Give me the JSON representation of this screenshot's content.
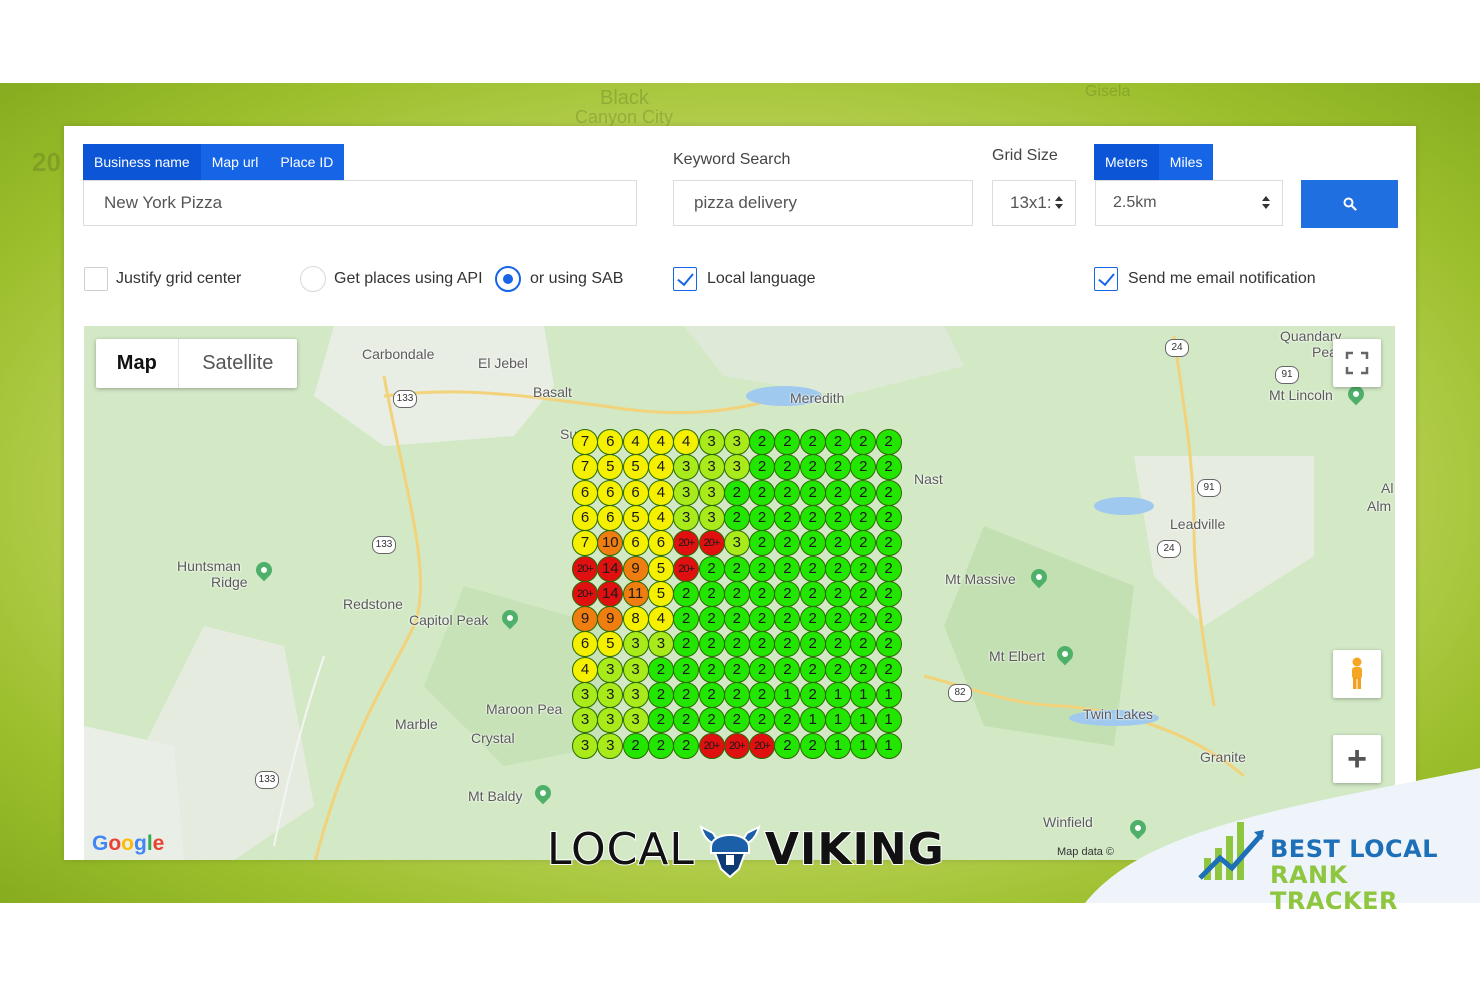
{
  "colors": {
    "accent": "#1565e6",
    "rank_red": "#e01010",
    "rank_orange": "#f07d10",
    "rank_yellow": "#f5f000",
    "rank_lime": "#a8ea1a",
    "rank_green": "#22e600"
  },
  "tabs": {
    "search_by": [
      {
        "label": "Business name",
        "active": true
      },
      {
        "label": "Map url",
        "active": false
      },
      {
        "label": "Place ID",
        "active": false
      }
    ],
    "units": [
      {
        "label": "Meters",
        "active": true
      },
      {
        "label": "Miles",
        "active": false
      }
    ]
  },
  "inputs": {
    "business_value": "New York Pizza",
    "keyword_label": "Keyword Search",
    "keyword_value": "pizza delivery",
    "grid_label": "Grid Size",
    "grid_value": "13x1:",
    "distance_value": "2.5km"
  },
  "search_button": {
    "icon": "search-icon"
  },
  "options": {
    "justify": {
      "label": "Justify grid center",
      "checked": false
    },
    "api": {
      "label": "Get places using API",
      "selected": false
    },
    "sab": {
      "label": "or using SAB",
      "selected": true
    },
    "local_language": {
      "label": "Local language",
      "checked": true
    },
    "email": {
      "label": "Send me email notification",
      "checked": true
    }
  },
  "map": {
    "type_buttons": {
      "map": "Map",
      "satellite": "Satellite"
    },
    "places": [
      {
        "name": "Carbondale"
      },
      {
        "name": "El Jebel"
      },
      {
        "name": "Basalt"
      },
      {
        "name": "Meredith"
      },
      {
        "name": "Quandary"
      },
      {
        "name": "Pea"
      },
      {
        "name": "Mt Lincoln"
      },
      {
        "name": "Nast"
      },
      {
        "name": "Leadville"
      },
      {
        "name": "Al"
      },
      {
        "name": "Alm"
      },
      {
        "name": "Huntsman"
      },
      {
        "name": "Ridge"
      },
      {
        "name": "Redstone"
      },
      {
        "name": "Capitol Peak"
      },
      {
        "name": "Mt Massive"
      },
      {
        "name": "Mt Elbert"
      },
      {
        "name": "Maroon Pea"
      },
      {
        "name": "Marble"
      },
      {
        "name": "Crystal"
      },
      {
        "name": "Twin Lakes"
      },
      {
        "name": "Granite"
      },
      {
        "name": "Mt Baldy"
      },
      {
        "name": "Winfield"
      },
      {
        "name": "Su"
      }
    ],
    "shields": [
      "133",
      "133",
      "133",
      "24",
      "24",
      "91",
      "91",
      "82"
    ],
    "attribution": "Map data ©",
    "google": "Google",
    "controls": {
      "fullscreen": "fullscreen-icon",
      "pegman": "pegman-icon",
      "zoom_in": "+"
    }
  },
  "rank_grid": {
    "rows": [
      [
        "7",
        "6",
        "4",
        "4",
        "4",
        "3",
        "3",
        "2",
        "2",
        "2",
        "2",
        "2",
        "2"
      ],
      [
        "7",
        "5",
        "5",
        "4",
        "3",
        "3",
        "3",
        "2",
        "2",
        "2",
        "2",
        "2",
        "2"
      ],
      [
        "6",
        "6",
        "6",
        "4",
        "3",
        "3",
        "2",
        "2",
        "2",
        "2",
        "2",
        "2",
        "2"
      ],
      [
        "6",
        "6",
        "5",
        "4",
        "3",
        "3",
        "2",
        "2",
        "2",
        "2",
        "2",
        "2",
        "2"
      ],
      [
        "7",
        "10",
        "6",
        "6",
        "20+",
        "20+",
        "3",
        "2",
        "2",
        "2",
        "2",
        "2",
        "2"
      ],
      [
        "20+",
        "14",
        "9",
        "5",
        "20+",
        "2",
        "2",
        "2",
        "2",
        "2",
        "2",
        "2",
        "2"
      ],
      [
        "20+",
        "14",
        "11",
        "5",
        "2",
        "2",
        "2",
        "2",
        "2",
        "2",
        "2",
        "2",
        "2"
      ],
      [
        "9",
        "9",
        "8",
        "4",
        "2",
        "2",
        "2",
        "2",
        "2",
        "2",
        "2",
        "2",
        "2"
      ],
      [
        "6",
        "5",
        "3",
        "3",
        "2",
        "2",
        "2",
        "2",
        "2",
        "2",
        "2",
        "2",
        "2"
      ],
      [
        "4",
        "3",
        "3",
        "2",
        "2",
        "2",
        "2",
        "2",
        "2",
        "2",
        "2",
        "2",
        "2"
      ],
      [
        "3",
        "3",
        "3",
        "2",
        "2",
        "2",
        "2",
        "2",
        "1",
        "2",
        "1",
        "1",
        "1"
      ],
      [
        "3",
        "3",
        "3",
        "2",
        "2",
        "2",
        "2",
        "2",
        "2",
        "1",
        "1",
        "1",
        "1"
      ],
      [
        "3",
        "3",
        "2",
        "2",
        "2",
        "20+",
        "20+",
        "20+",
        "2",
        "2",
        "1",
        "1",
        "1"
      ]
    ]
  },
  "brands": {
    "localviking_a": "LOCAL",
    "localviking_b": "VIKING",
    "blrt_line1": "BEST LOCAL",
    "blrt_line2": "RANK TRACKER"
  }
}
